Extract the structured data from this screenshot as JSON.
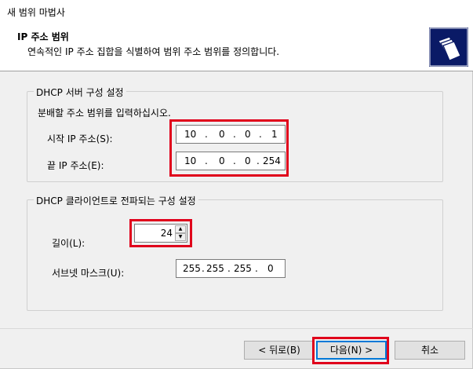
{
  "window": {
    "title": "새 범위 마법사"
  },
  "header": {
    "title": "IP 주소 범위",
    "subtitle": "연속적인 IP 주소 집합을 식별하여 범위 주소 범위를 정의합니다.",
    "icon": "folder-stack-icon"
  },
  "server_group": {
    "legend": "DHCP 서버 구성 설정",
    "instruction": "분배할 주소 범위를 입력하십시오.",
    "start_ip": {
      "label": "시작 IP 주소(S):",
      "octets": [
        "10",
        "0",
        "0",
        "1"
      ]
    },
    "end_ip": {
      "label": "끝 IP 주소(E):",
      "octets": [
        "10",
        "0",
        "0",
        "254"
      ]
    }
  },
  "client_group": {
    "legend": "DHCP 클라이언트로 전파되는 구성 설정",
    "length": {
      "label": "길이(L):",
      "value": "24"
    },
    "subnet_mask": {
      "label": "서브넷 마스크(U):",
      "octets": [
        "255",
        "255",
        "255",
        "0"
      ]
    }
  },
  "buttons": {
    "back": "< 뒤로(B)",
    "next": "다음(N) >",
    "cancel": "취소"
  },
  "highlight_color": "#e0001b"
}
